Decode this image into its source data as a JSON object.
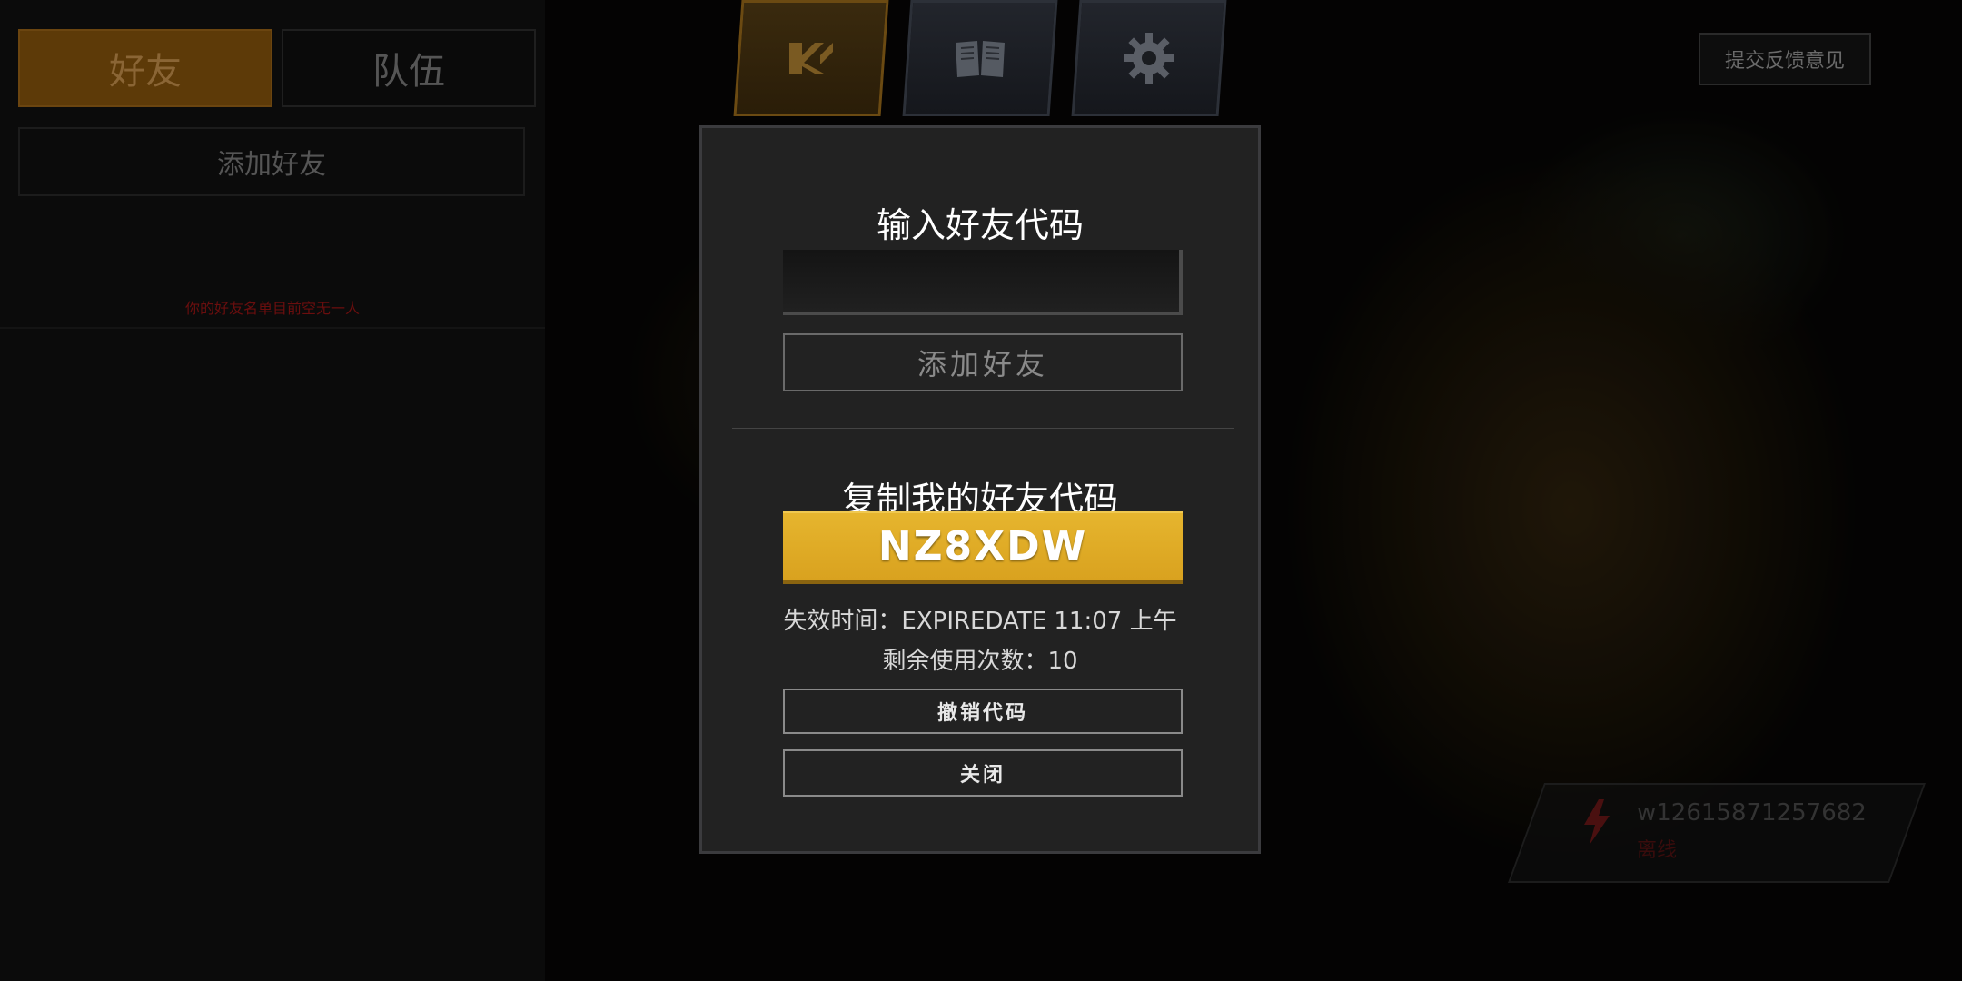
{
  "left_panel": {
    "tabs": [
      {
        "label": "好友",
        "active": true
      },
      {
        "label": "队伍",
        "active": false
      }
    ],
    "add_friend_label": "添加好友",
    "empty_list_text": "你的好友名单目前空无一人"
  },
  "top_nav": {
    "items": [
      {
        "icon": "logo-icon",
        "active": true
      },
      {
        "icon": "book-icon",
        "active": false
      },
      {
        "icon": "gear-icon",
        "active": false
      }
    ]
  },
  "feedback_label": "提交反馈意见",
  "user_card": {
    "user_id": "w12615871257682",
    "status": "离线"
  },
  "modal": {
    "enter_code_title": "输入好友代码",
    "code_input_value": "",
    "add_friend_label": "添加好友",
    "copy_code_title": "复制我的好友代码",
    "friend_code": "NZ8XDW",
    "expire_text": "失效时间：EXPIREDATE 11:07 上午",
    "uses_text": "剩余使用次数：10",
    "revoke_label": "撤销代码",
    "close_label": "关闭"
  },
  "colors": {
    "accent_gold": "#e0ac26",
    "modal_bg": "#222222",
    "active_tab": "#5d3a08"
  }
}
